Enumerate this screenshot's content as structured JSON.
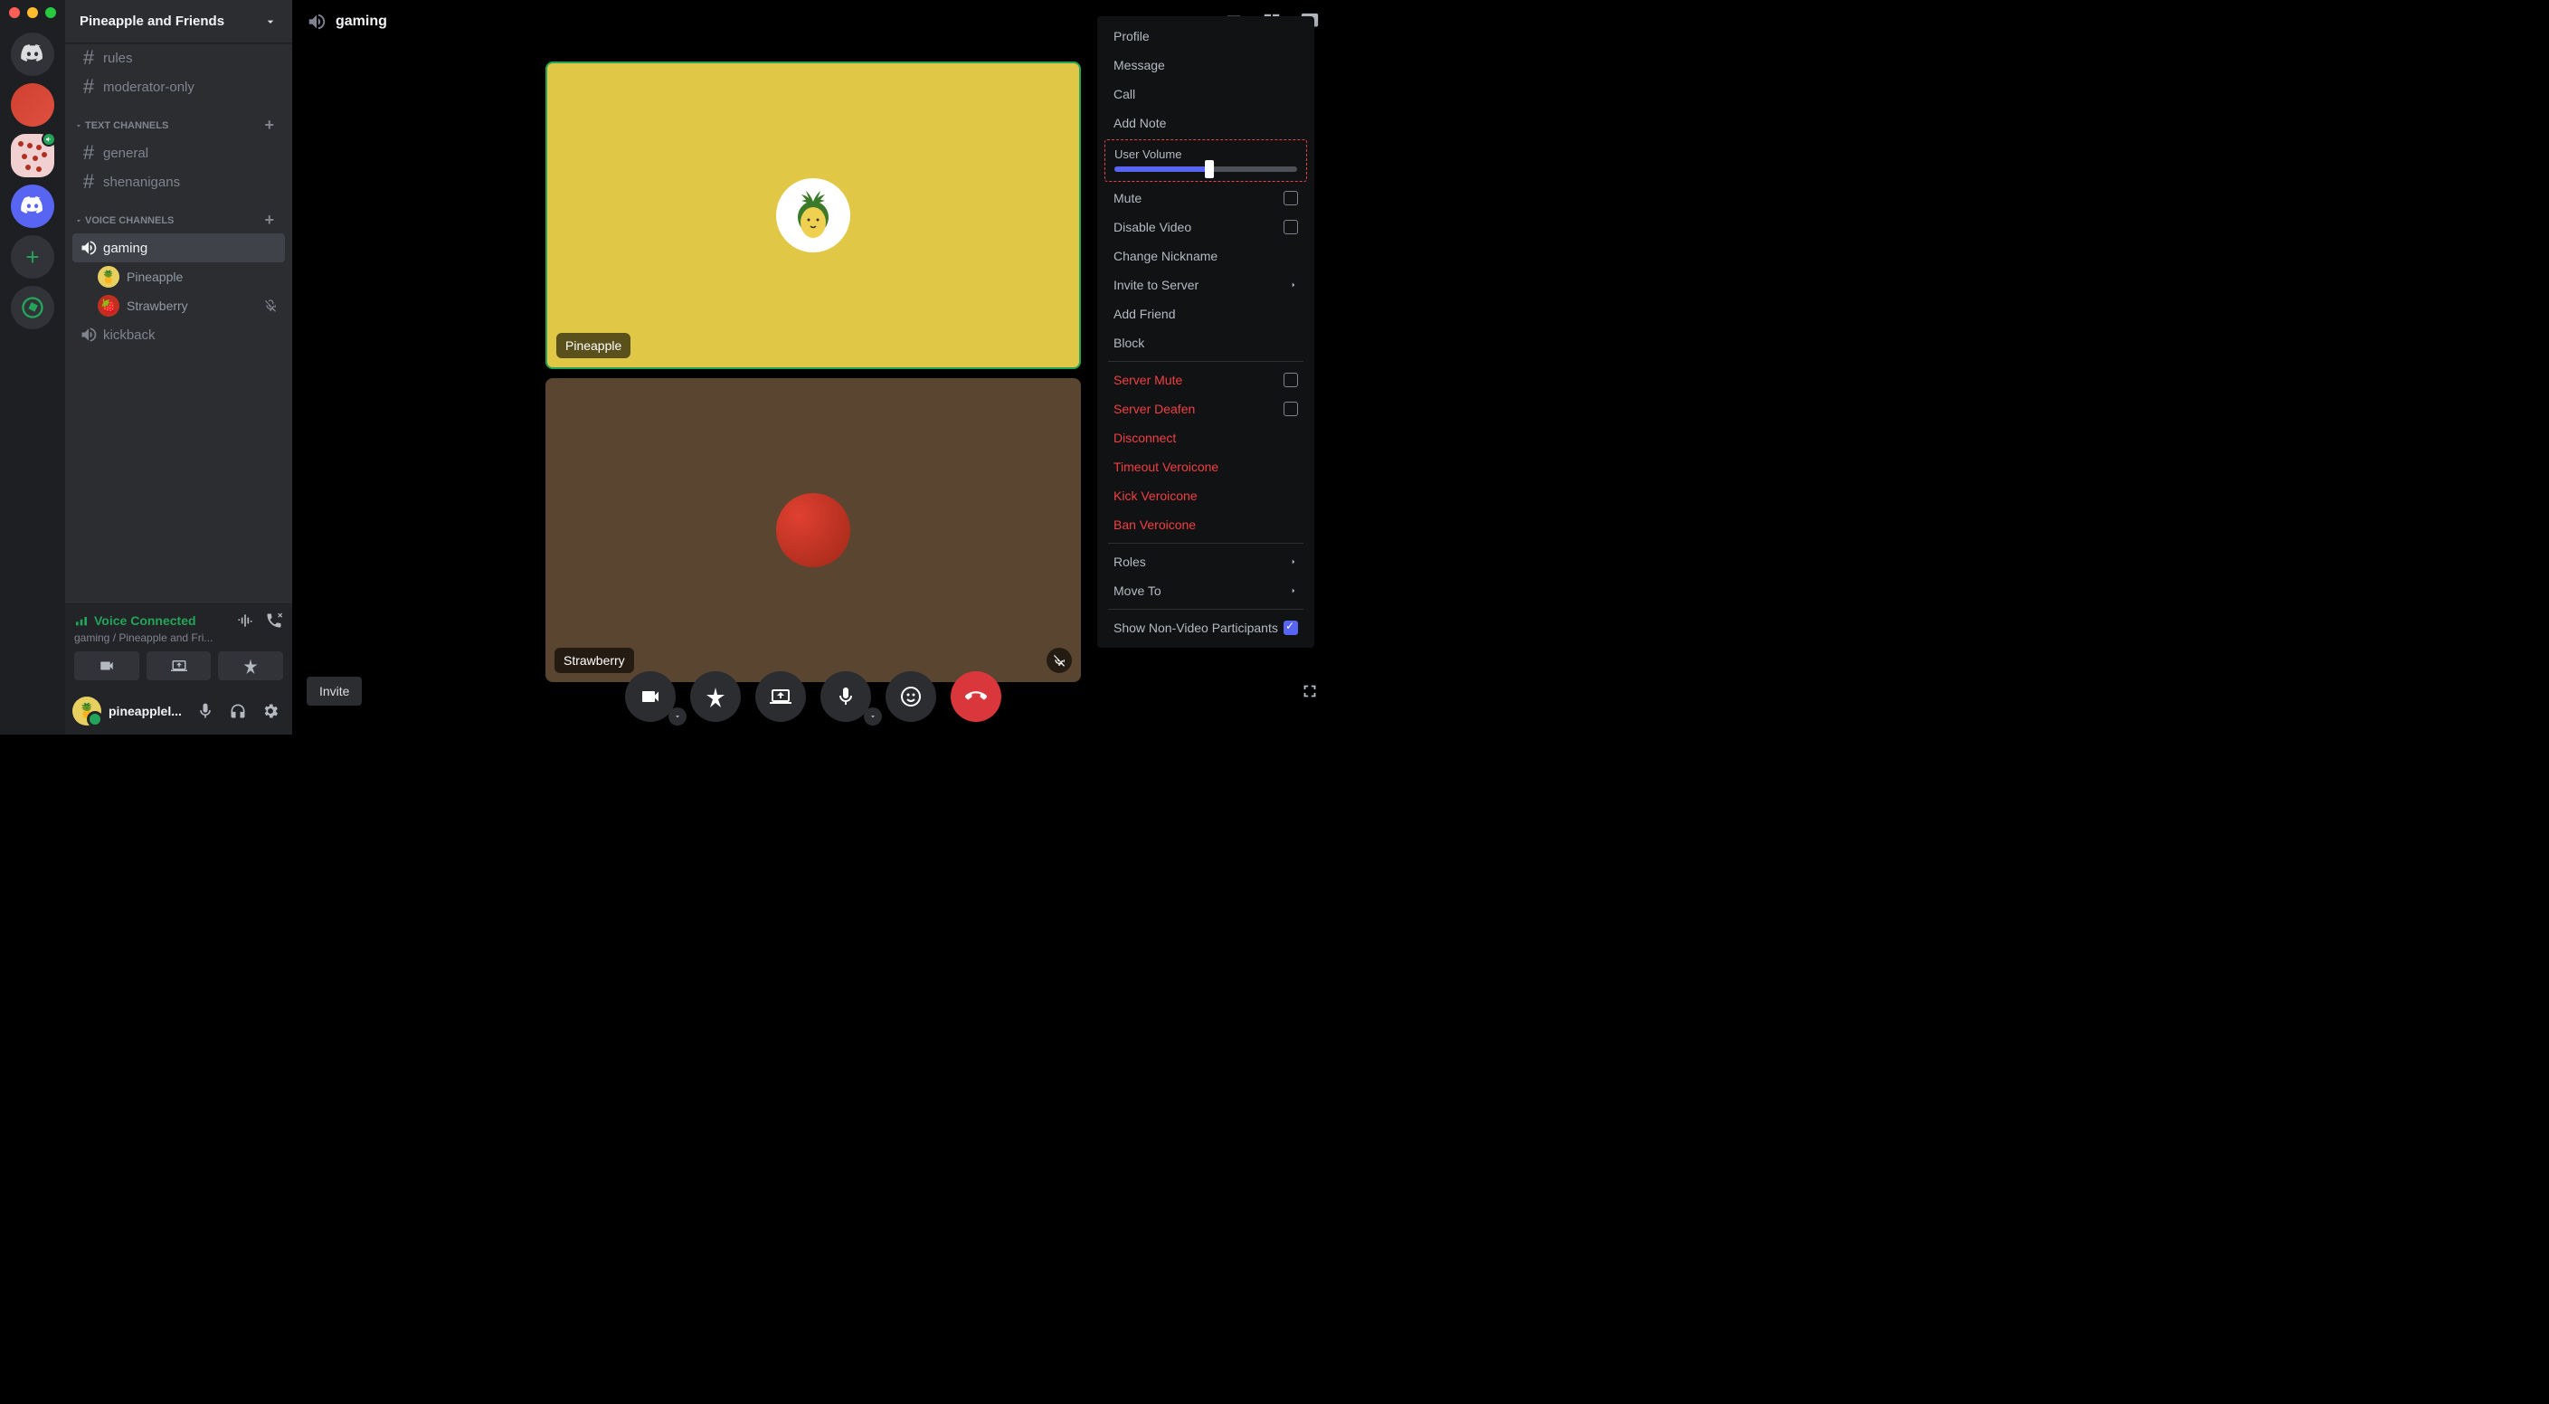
{
  "server": {
    "name": "Pineapple and Friends"
  },
  "channels": {
    "top": [
      {
        "name": "rules"
      },
      {
        "name": "moderator-only"
      }
    ],
    "text_category": "TEXT CHANNELS",
    "text": [
      {
        "name": "general"
      },
      {
        "name": "shenanigans"
      }
    ],
    "voice_category": "VOICE CHANNELS",
    "voice": [
      {
        "name": "gaming",
        "active": true
      },
      {
        "name": "kickback"
      }
    ],
    "voice_users": [
      {
        "name": "Pineapple",
        "muted": false
      },
      {
        "name": "Strawberry",
        "muted": true
      }
    ]
  },
  "voice_panel": {
    "status": "Voice Connected",
    "sub": "gaming / Pineapple and Fri..."
  },
  "user": {
    "name": "pineapplel..."
  },
  "main": {
    "title": "gaming",
    "invite": "Invite",
    "tiles": [
      {
        "name": "Pineapple"
      },
      {
        "name": "Strawberry"
      }
    ]
  },
  "context_menu": {
    "profile": "Profile",
    "message": "Message",
    "call": "Call",
    "add_note": "Add Note",
    "user_volume": "User Volume",
    "volume_percent": 52,
    "mute": "Mute",
    "disable_video": "Disable Video",
    "change_nickname": "Change Nickname",
    "invite_to_server": "Invite to Server",
    "add_friend": "Add Friend",
    "block": "Block",
    "server_mute": "Server Mute",
    "server_deafen": "Server Deafen",
    "disconnect": "Disconnect",
    "timeout": "Timeout Veroicone",
    "kick": "Kick Veroicone",
    "ban": "Ban Veroicone",
    "roles": "Roles",
    "move_to": "Move To",
    "show_non_video": "Show Non-Video Participants"
  }
}
